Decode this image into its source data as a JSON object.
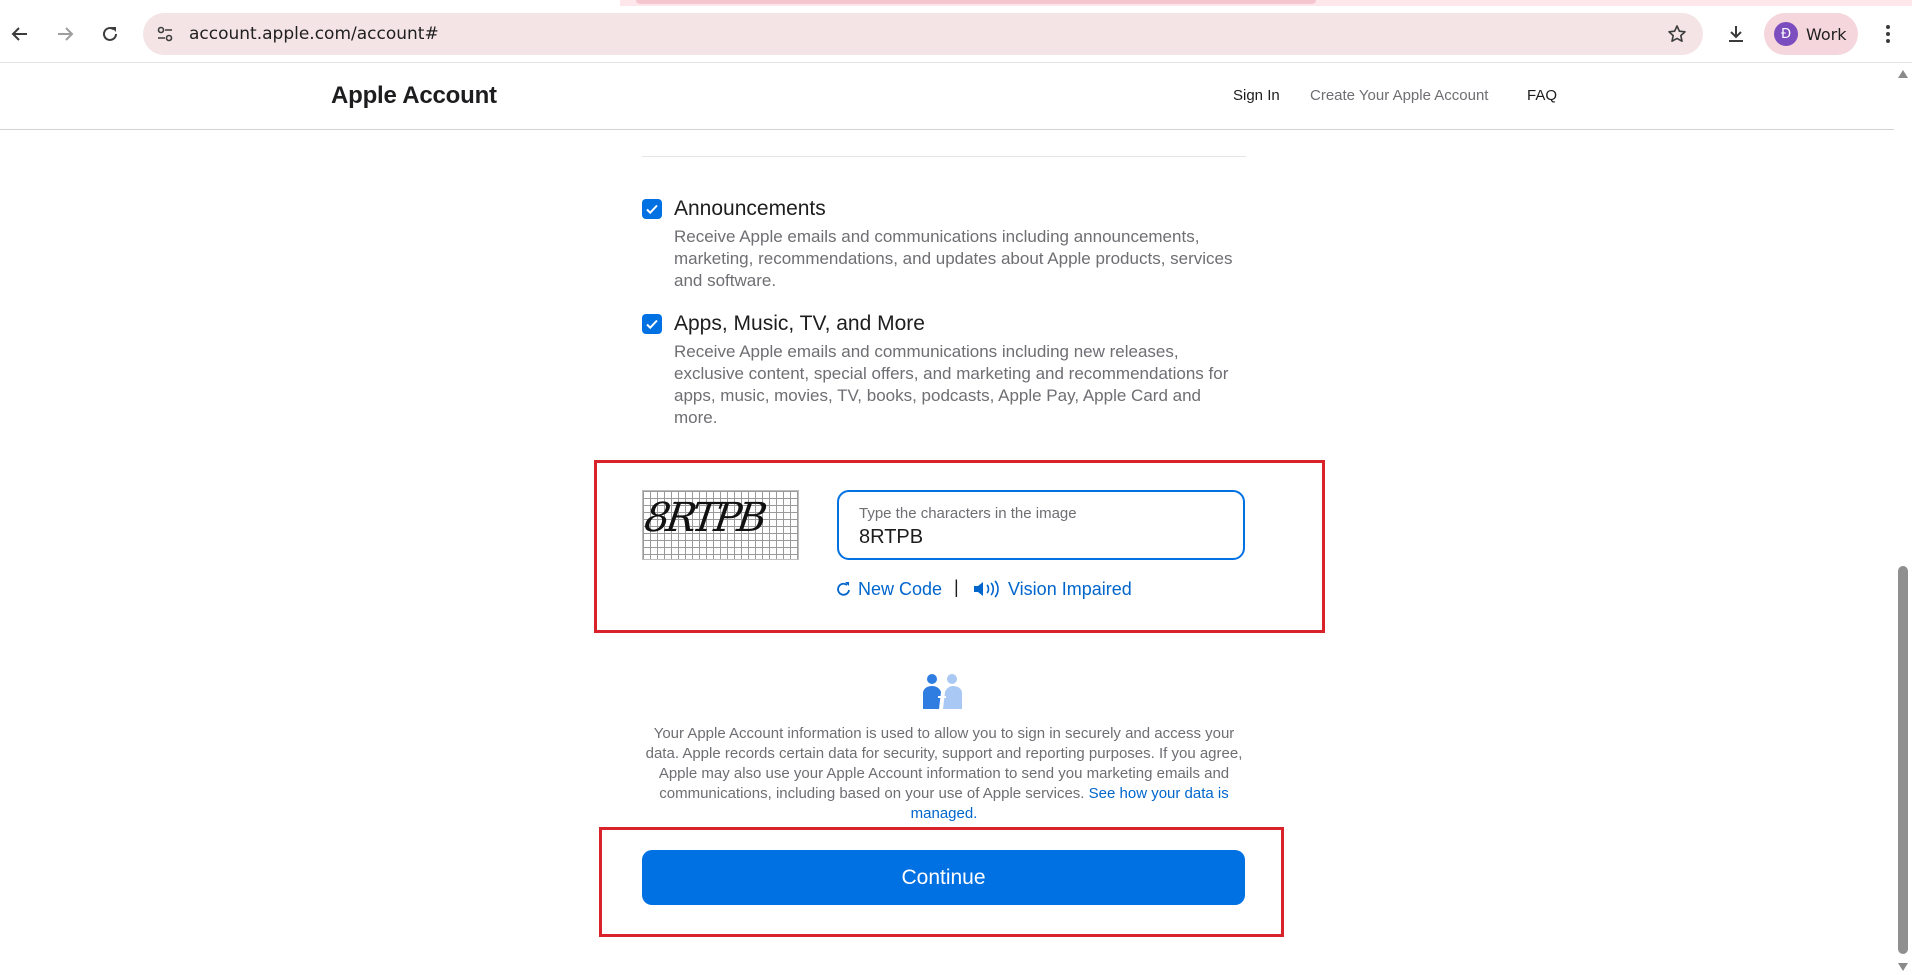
{
  "browser": {
    "url": "account.apple.com/account#",
    "profile_initial": "Đ",
    "profile_name": "Work",
    "icons": [
      "back-icon",
      "forward-icon",
      "reload-icon",
      "site-settings-icon",
      "bookmark-star-icon",
      "download-icon",
      "kebab-menu-icon"
    ]
  },
  "header": {
    "brand": "Apple Account",
    "nav": {
      "sign_in": "Sign In",
      "create": "Create Your Apple Account",
      "faq": "FAQ"
    }
  },
  "preferences": [
    {
      "title": "Announcements",
      "description": "Receive Apple emails and communications including announcements, marketing, recommendations, and updates about Apple products, services and software.",
      "checked": true
    },
    {
      "title": "Apps, Music, TV, and More",
      "description": "Receive Apple emails and communications including new releases, exclusive content, special offers, and marketing and recommendations for apps, music, movies, TV, books, podcasts, Apple Pay, Apple Card and more.",
      "checked": true
    }
  ],
  "captcha": {
    "image_text": "8RTPB",
    "field_label": "Type the characters in the image",
    "field_value": "8RTPB",
    "new_code": "New Code",
    "separator": "|",
    "vision_impaired": "Vision Impaired"
  },
  "privacy": {
    "text": "Your Apple Account information is used to allow you to sign in securely and access your data. Apple records certain data for security, support and reporting purposes. If you agree, Apple may also use your Apple Account information to send you marketing emails and communications, including based on your use of Apple services.",
    "link": "See how your data is managed."
  },
  "continue_label": "Continue",
  "colors": {
    "accent": "#0071e3",
    "link": "#0066cc",
    "highlight": "#d8232a"
  }
}
